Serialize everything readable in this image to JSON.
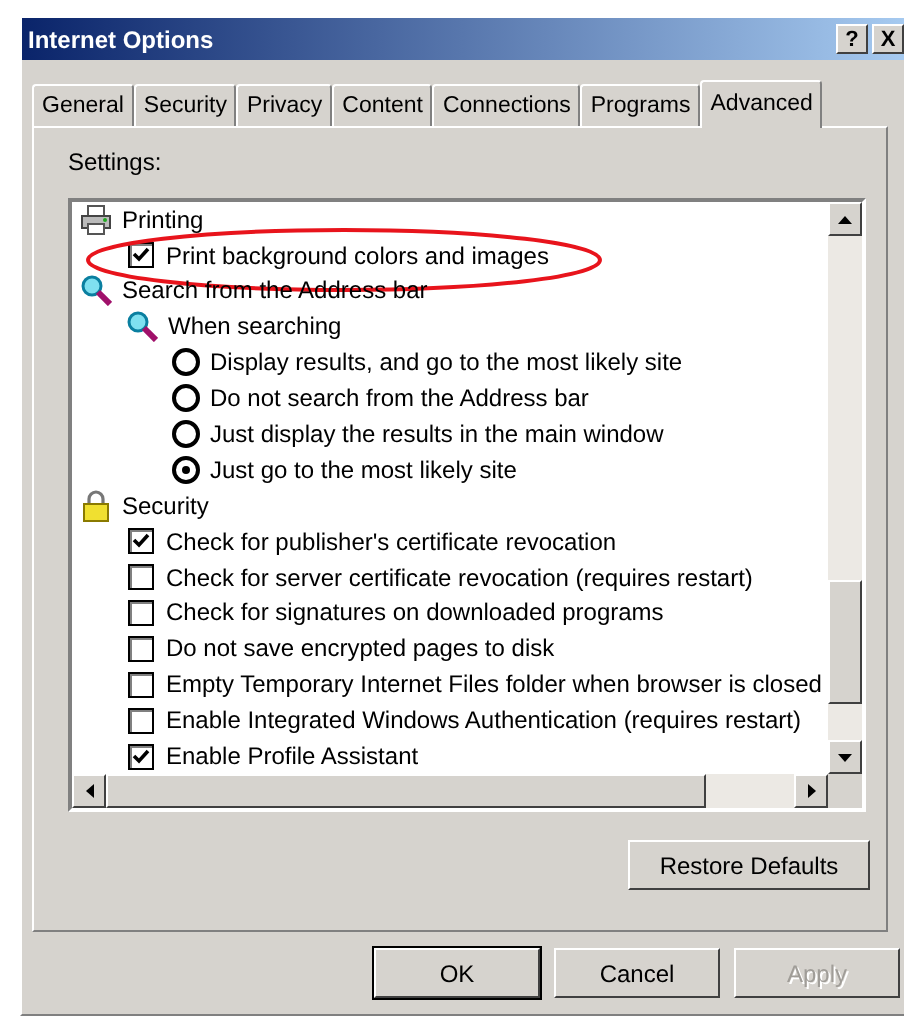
{
  "window": {
    "title": "Internet Options",
    "title_buttons": [
      "?",
      "X"
    ]
  },
  "tabs": [
    {
      "label": "General",
      "selected": false
    },
    {
      "label": "Security",
      "selected": false
    },
    {
      "label": "Privacy",
      "selected": false
    },
    {
      "label": "Content",
      "selected": false
    },
    {
      "label": "Connections",
      "selected": false
    },
    {
      "label": "Programs",
      "selected": false
    },
    {
      "label": "Advanced",
      "selected": true
    }
  ],
  "settings": {
    "label": "Settings:",
    "items": [
      {
        "kind": "printer",
        "label": "Printing",
        "children": [
          {
            "kind": "checkbox",
            "label": "Print background colors and images",
            "checked": true,
            "highlighted": true
          }
        ]
      },
      {
        "kind": "search",
        "label": "Search from the Address bar",
        "children": [
          {
            "kind": "search",
            "label": "When searching",
            "children": [
              {
                "kind": "radio",
                "label": "Display results, and go to the most likely site",
                "selected": false
              },
              {
                "kind": "radio",
                "label": "Do not search from the Address bar",
                "selected": false
              },
              {
                "kind": "radio",
                "label": "Just display the results in the main window",
                "selected": false
              },
              {
                "kind": "radio",
                "label": "Just go to the most likely site",
                "selected": true
              }
            ]
          }
        ]
      },
      {
        "kind": "lock",
        "label": "Security",
        "children": [
          {
            "kind": "checkbox",
            "label": "Check for publisher's certificate revocation",
            "checked": true
          },
          {
            "kind": "checkbox",
            "label": "Check for server certificate revocation (requires restart)",
            "checked": false
          },
          {
            "kind": "checkbox",
            "label": "Check for signatures on downloaded programs",
            "checked": false
          },
          {
            "kind": "checkbox",
            "label": "Do not save encrypted pages to disk",
            "checked": false
          },
          {
            "kind": "checkbox",
            "label": "Empty Temporary Internet Files folder when browser is closed",
            "checked": false
          },
          {
            "kind": "checkbox",
            "label": "Enable Integrated Windows Authentication (requires restart)",
            "checked": false
          },
          {
            "kind": "checkbox",
            "label": "Enable Profile Assistant",
            "checked": true
          }
        ]
      }
    ]
  },
  "restore_button": "Restore Defaults",
  "buttons": [
    {
      "label": "OK",
      "default": true,
      "disabled": false
    },
    {
      "label": "Cancel",
      "default": false,
      "disabled": false
    },
    {
      "label": "Apply",
      "default": false,
      "disabled": true
    }
  ]
}
